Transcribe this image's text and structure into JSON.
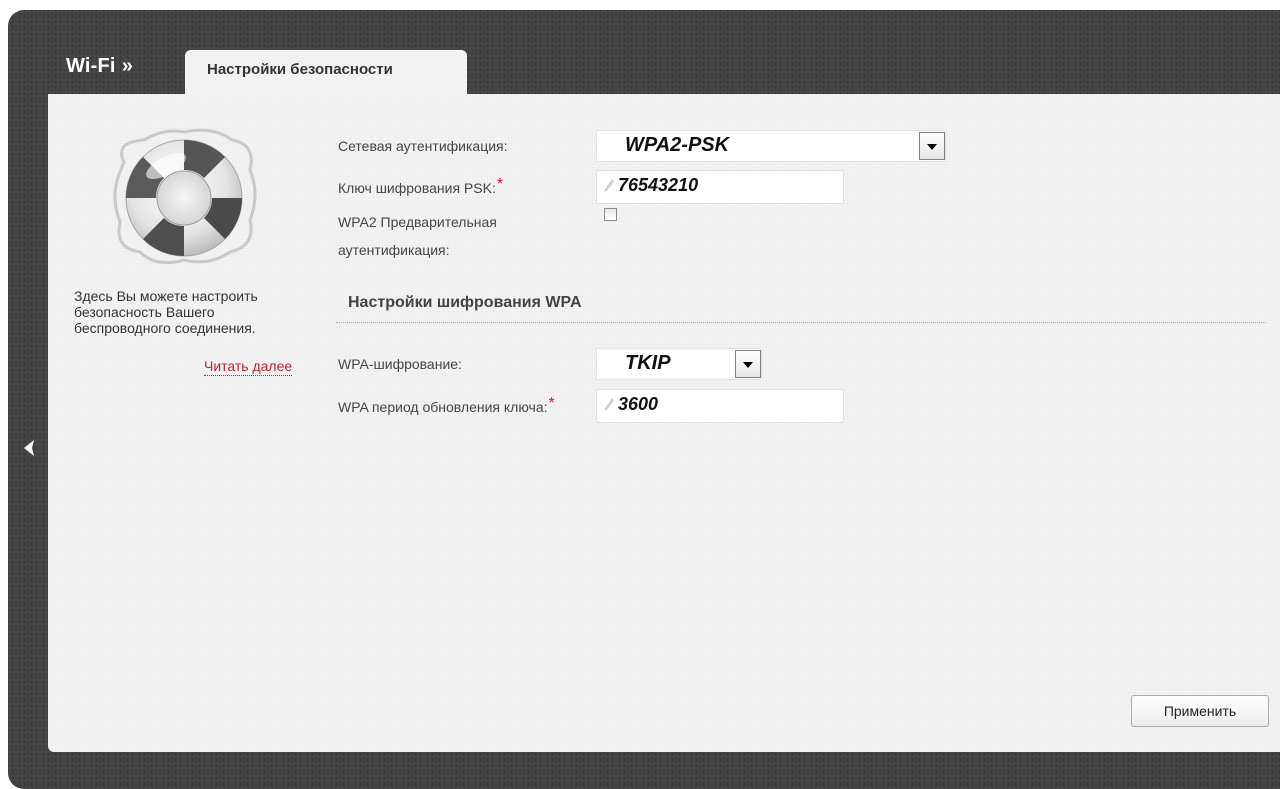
{
  "header": {
    "root_label": "Wi-Fi",
    "separator": "»",
    "active_tab_label": "Настройки безопасности"
  },
  "sidebar": {
    "help_text": "Здесь Вы можете настроить безопасность Вашего беспроводного соединения.",
    "read_more_label": "Читать далее",
    "icon": "lifebuoy-icon"
  },
  "form": {
    "auth": {
      "label": "Сетевая аутентификация:",
      "value": "WPA2-PSK"
    },
    "psk": {
      "label": "Ключ шифрования PSK:",
      "required_mark": "*",
      "value": "76543210"
    },
    "preauth": {
      "label_line1": "WPA2 Предварительная",
      "label_line2": "аутентификация:",
      "checked": false
    },
    "wpa_section_title": "Настройки шифрования WPA",
    "wpa_encryption": {
      "label": "WPA-шифрование:",
      "value": "TKIP"
    },
    "rekey_period": {
      "label": "WPA период обновления ключа:",
      "required_mark": "*",
      "value": "3600"
    }
  },
  "actions": {
    "apply_label": "Применить"
  },
  "colors": {
    "frame_dark": "#424242",
    "panel_bg": "#f3f3f3",
    "link_red": "#b6232a",
    "required_red": "#d8102a"
  }
}
